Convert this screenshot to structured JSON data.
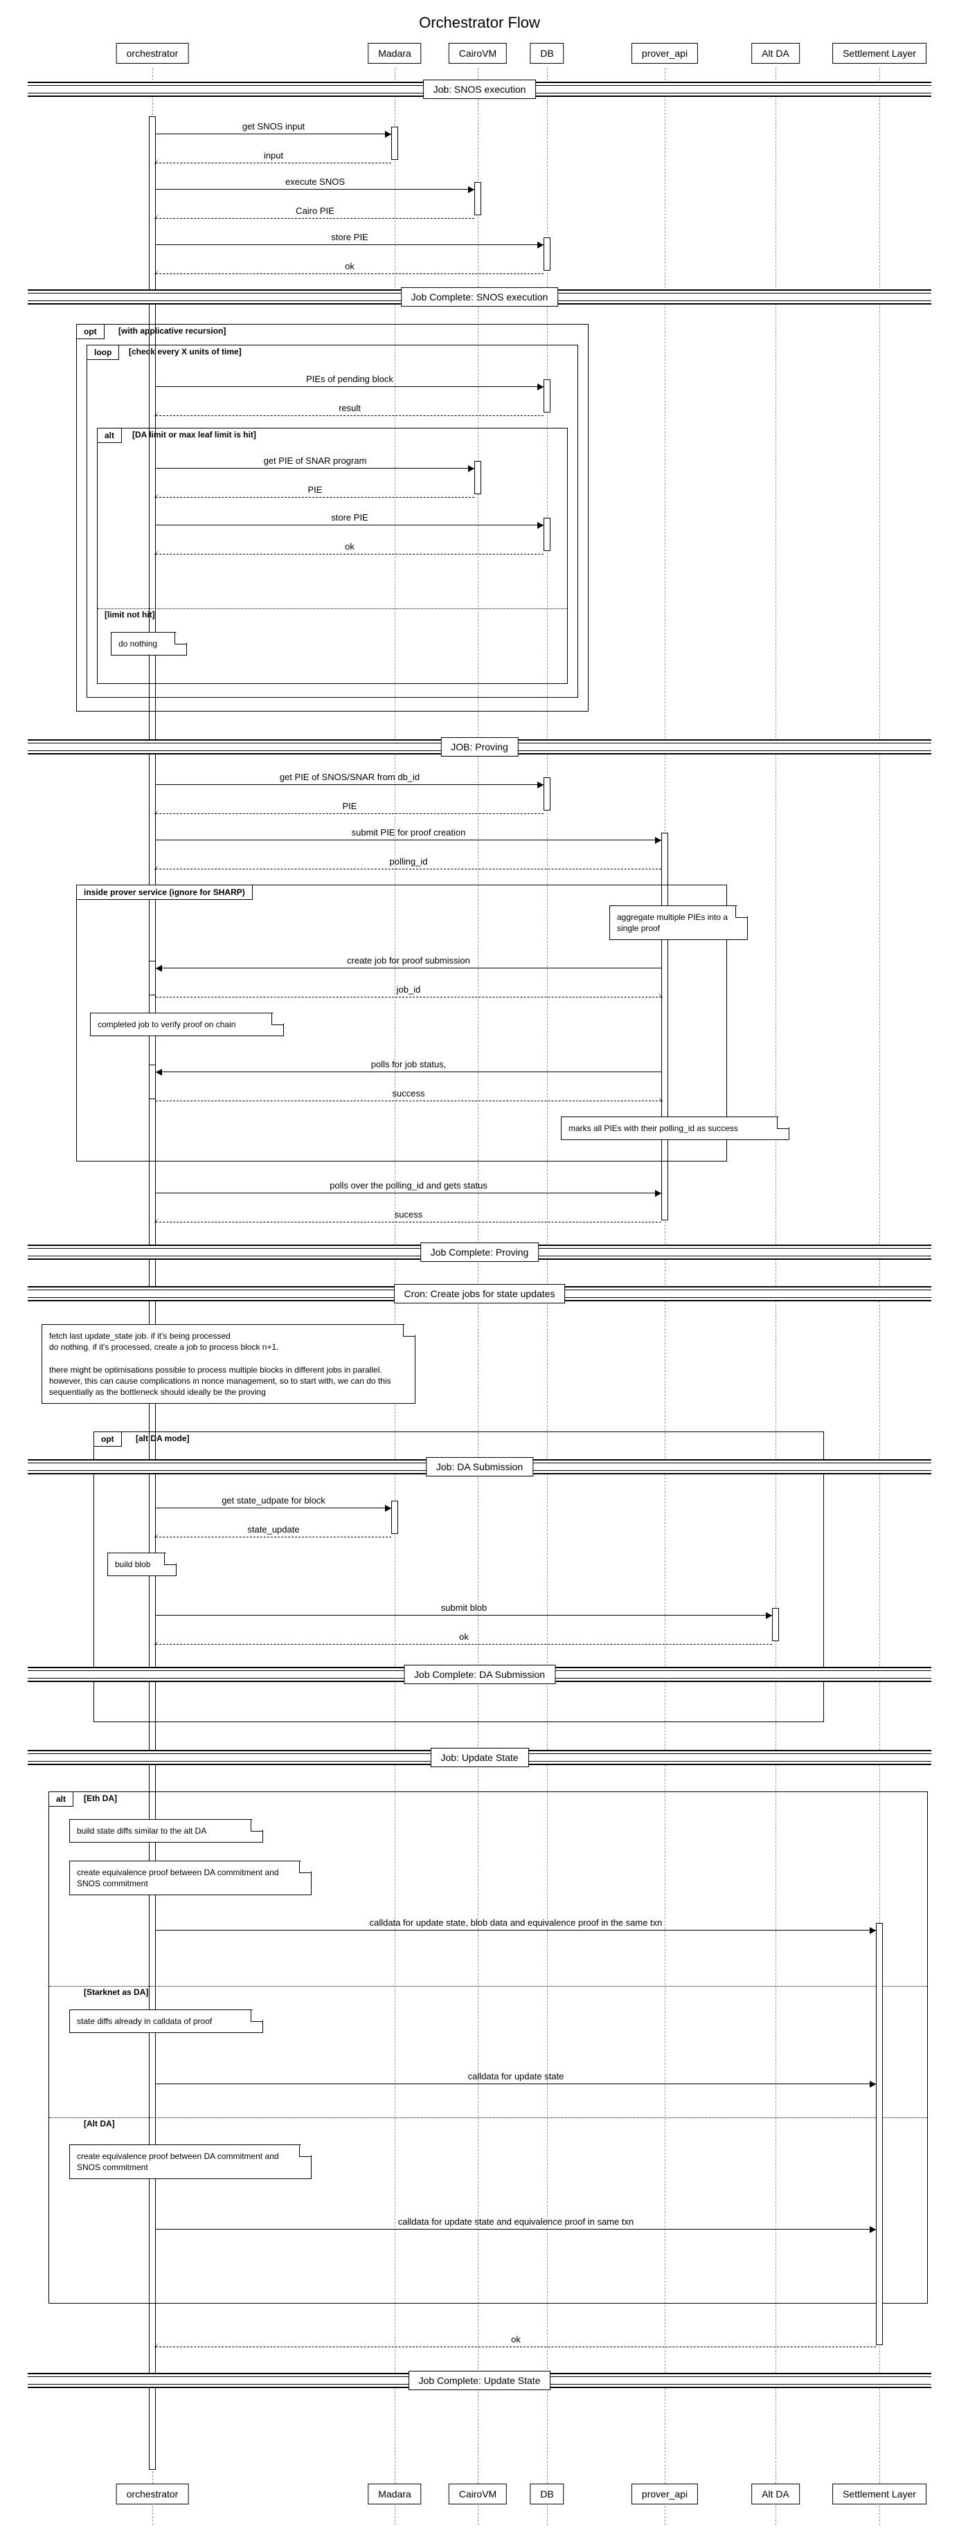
{
  "title": "Orchestrator Flow",
  "actors": {
    "orchestrator": "orchestrator",
    "madara": "Madara",
    "cairovm": "CairoVM",
    "db": "DB",
    "prover": "prover_api",
    "altda": "Alt DA",
    "settlement": "Settlement Layer"
  },
  "dividers": {
    "job_snos": "Job: SNOS execution",
    "job_snos_complete": "Job Complete: SNOS execution",
    "job_proving": "JOB: Proving",
    "job_proving_complete": "Job Complete: Proving",
    "cron": "Cron: Create jobs for state updates",
    "job_da": "Job: DA Submission",
    "job_da_complete": "Job Complete: DA Submission",
    "job_update": "Job: Update State",
    "job_update_complete": "Job Complete: Update State"
  },
  "frames": {
    "opt_recursion": {
      "tag": "opt",
      "guard": "[with applicative recursion]"
    },
    "loop_check": {
      "tag": "loop",
      "guard": "[check every X units of time]"
    },
    "alt_limit": {
      "tag": "alt",
      "guard1": "[DA limit or max leaf limit is hit]",
      "guard2": "[limit not hit]"
    },
    "prover_frame": {
      "tag": "inside prover service (ignore for SHARP)"
    },
    "opt_altda": {
      "tag": "opt",
      "guard": "[alt DA mode]"
    },
    "alt_da": {
      "tag": "alt",
      "g1": "[Eth DA]",
      "g2": "[Starknet as DA]",
      "g3": "[Alt DA]"
    }
  },
  "messages": {
    "m1": "get SNOS input",
    "m2": "input",
    "m3": "execute SNOS",
    "m4": "Cairo PIE",
    "m5": "store PIE",
    "m6": "ok",
    "m7": "PIEs of pending block",
    "m8": "result",
    "m9": "get PIE of SNAR program",
    "m10": "PIE",
    "m11": "store PIE",
    "m12": "ok",
    "m13": "get PIE of SNOS/SNAR from db_id",
    "m14": "PIE",
    "m15": "submit PIE for proof creation",
    "m16": "polling_id",
    "m17": "create job for proof submission",
    "m18": "job_id",
    "m19": "polls for job status,",
    "m20": "success",
    "m21": "polls over the polling_id and gets status",
    "m22": "sucess",
    "m23": "get state_udpate for block",
    "m24": "state_update",
    "m25": "submit blob",
    "m26": "ok",
    "m27": "calldata for update state, blob data and equivalence proof in the same txn",
    "m28": "calldata for update state",
    "m29": "calldata for update state and equivalence proof in same txn",
    "m30": "ok"
  },
  "notes": {
    "n_do_nothing": "do nothing",
    "n_aggregate": "aggregate multiple PIEs into a single proof",
    "n_completed": "completed job to verify proof on chain",
    "n_marks": "marks all PIEs with their polling_id as success",
    "n_fetch": "fetch last update_state job. if it's being processed\ndo nothing. if it's processed, create a job to process block n+1.\n\nthere might be optimisations possible to process multiple blocks in different jobs in parallel. however, this can cause complications in nonce management, so to start with, we can do this sequentially as the bottleneck should ideally be the proving",
    "n_build_blob": "build blob",
    "n_build_state": "build state diffs similar to the alt DA",
    "n_equiv1": "create equivalence proof between DA commitment and SNOS commitment",
    "n_state_in_calldata": "state diffs already in calldata of proof",
    "n_equiv2": "create equivalence proof between DA commitment and SNOS commitment"
  },
  "chart_data": {
    "type": "sequence-diagram",
    "title": "Orchestrator Flow",
    "participants": [
      "orchestrator",
      "Madara",
      "CairoVM",
      "DB",
      "prover_api",
      "Alt DA",
      "Settlement Layer"
    ],
    "sections": [
      {
        "divider": "Job: SNOS execution",
        "messages": [
          {
            "from": "orchestrator",
            "to": "Madara",
            "text": "get SNOS input",
            "style": "sync"
          },
          {
            "from": "Madara",
            "to": "orchestrator",
            "text": "input",
            "style": "reply"
          },
          {
            "from": "orchestrator",
            "to": "CairoVM",
            "text": "execute SNOS",
            "style": "sync"
          },
          {
            "from": "CairoVM",
            "to": "orchestrator",
            "text": "Cairo PIE",
            "style": "reply"
          },
          {
            "from": "orchestrator",
            "to": "DB",
            "text": "store PIE",
            "style": "sync"
          },
          {
            "from": "DB",
            "to": "orchestrator",
            "text": "ok",
            "style": "reply"
          }
        ]
      },
      {
        "divider": "Job Complete: SNOS execution"
      },
      {
        "frame": "opt [with applicative recursion]",
        "children": [
          {
            "frame": "loop [check every X units of time]",
            "messages": [
              {
                "from": "orchestrator",
                "to": "DB",
                "text": "PIEs of pending block",
                "style": "sync"
              },
              {
                "from": "DB",
                "to": "orchestrator",
                "text": "result",
                "style": "reply"
              }
            ],
            "children": [
              {
                "frame": "alt",
                "branches": [
                  {
                    "guard": "[DA limit or max leaf limit is hit]",
                    "messages": [
                      {
                        "from": "orchestrator",
                        "to": "CairoVM",
                        "text": "get PIE of SNAR program",
                        "style": "sync"
                      },
                      {
                        "from": "CairoVM",
                        "to": "orchestrator",
                        "text": "PIE",
                        "style": "reply"
                      },
                      {
                        "from": "orchestrator",
                        "to": "DB",
                        "text": "store PIE",
                        "style": "sync"
                      },
                      {
                        "from": "DB",
                        "to": "orchestrator",
                        "text": "ok",
                        "style": "reply"
                      }
                    ]
                  },
                  {
                    "guard": "[limit not hit]",
                    "notes": [
                      {
                        "over": "orchestrator",
                        "text": "do nothing"
                      }
                    ]
                  }
                ]
              }
            ]
          }
        ]
      },
      {
        "divider": "JOB: Proving"
      },
      {
        "messages": [
          {
            "from": "orchestrator",
            "to": "DB",
            "text": "get PIE of SNOS/SNAR from db_id",
            "style": "sync"
          },
          {
            "from": "DB",
            "to": "orchestrator",
            "text": "PIE",
            "style": "reply"
          },
          {
            "from": "orchestrator",
            "to": "prover_api",
            "text": "submit PIE for proof creation",
            "style": "sync"
          },
          {
            "from": "prover_api",
            "to": "orchestrator",
            "text": "polling_id",
            "style": "reply"
          }
        ]
      },
      {
        "frame": "inside prover service (ignore for SHARP)",
        "notes": [
          {
            "over": "prover_api",
            "text": "aggregate multiple PIEs into a single proof"
          }
        ],
        "messages": [
          {
            "from": "prover_api",
            "to": "orchestrator",
            "text": "create job for proof submission",
            "style": "sync"
          },
          {
            "from": "orchestrator",
            "to": "prover_api",
            "text": "job_id",
            "style": "reply"
          }
        ],
        "notes2": [
          {
            "over": "orchestrator",
            "text": "completed job to verify proof on chain"
          }
        ],
        "messages2": [
          {
            "from": "prover_api",
            "to": "orchestrator",
            "text": "polls for job status,",
            "style": "sync"
          },
          {
            "from": "orchestrator",
            "to": "prover_api",
            "text": "success",
            "style": "reply"
          }
        ],
        "notes3": [
          {
            "over": "prover_api",
            "text": "marks all PIEs with their polling_id as success"
          }
        ]
      },
      {
        "messages": [
          {
            "from": "orchestrator",
            "to": "prover_api",
            "text": "polls over the polling_id and gets status",
            "style": "sync"
          },
          {
            "from": "prover_api",
            "to": "orchestrator",
            "text": "sucess",
            "style": "reply"
          }
        ]
      },
      {
        "divider": "Job Complete: Proving"
      },
      {
        "divider": "Cron: Create jobs for state updates"
      },
      {
        "notes": [
          {
            "over": "orchestrator",
            "text": "fetch last update_state job. if it's being processed do nothing. if it's processed, create a job to process block n+1. there might be optimisations possible to process multiple blocks in different jobs in parallel. however, this can cause complications in nonce management, so to start with, we can do this sequentially as the bottleneck should ideally be the proving"
          }
        ]
      },
      {
        "frame": "opt [alt DA mode]",
        "children": [
          {
            "divider": "Job: DA Submission"
          },
          {
            "messages": [
              {
                "from": "orchestrator",
                "to": "Madara",
                "text": "get state_udpate for block",
                "style": "sync"
              },
              {
                "from": "Madara",
                "to": "orchestrator",
                "text": "state_update",
                "style": "reply"
              }
            ],
            "notes": [
              {
                "over": "orchestrator",
                "text": "build blob"
              }
            ],
            "messages2": [
              {
                "from": "orchestrator",
                "to": "Alt DA",
                "text": "submit blob",
                "style": "sync"
              },
              {
                "from": "Alt DA",
                "to": "orchestrator",
                "text": "ok",
                "style": "reply"
              }
            ]
          },
          {
            "divider": "Job Complete: DA Submission"
          }
        ]
      },
      {
        "divider": "Job: Update State"
      },
      {
        "frame": "alt",
        "branches": [
          {
            "guard": "[Eth DA]",
            "notes": [
              {
                "over": "orchestrator",
                "text": "build state diffs similar to the alt DA"
              },
              {
                "over": "orchestrator",
                "text": "create equivalence proof between DA commitment and SNOS commitment"
              }
            ],
            "messages": [
              {
                "from": "orchestrator",
                "to": "Settlement Layer",
                "text": "calldata for update state, blob data and equivalence proof in the same txn",
                "style": "sync"
              }
            ]
          },
          {
            "guard": "[Starknet as DA]",
            "notes": [
              {
                "over": "orchestrator",
                "text": "state diffs already in calldata of proof"
              }
            ],
            "messages": [
              {
                "from": "orchestrator",
                "to": "Settlement Layer",
                "text": "calldata for update state",
                "style": "sync"
              }
            ]
          },
          {
            "guard": "[Alt DA]",
            "notes": [
              {
                "over": "orchestrator",
                "text": "create equivalence proof between DA commitment and SNOS commitment"
              }
            ],
            "messages": [
              {
                "from": "orchestrator",
                "to": "Settlement Layer",
                "text": "calldata for update state and equivalence proof in same txn",
                "style": "sync"
              }
            ]
          }
        ]
      },
      {
        "messages": [
          {
            "from": "Settlement Layer",
            "to": "orchestrator",
            "text": "ok",
            "style": "reply"
          }
        ]
      },
      {
        "divider": "Job Complete: Update State"
      }
    ]
  }
}
